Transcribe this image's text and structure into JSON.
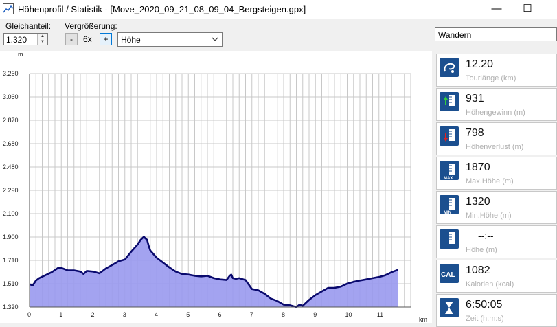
{
  "window": {
    "title": "Höhenprofil / Statistik - [Move_2020_09_21_08_09_04_Bergsteigen.gpx]",
    "minimize": "—",
    "maximize": "☐"
  },
  "toolbar": {
    "gleichanteil_label": "Gleichanteil:",
    "gleichanteil_value": "1.320",
    "zoom_label": "Vergrößerung:",
    "zoom_minus": "-",
    "zoom_value": "6x",
    "zoom_plus": "+",
    "mode_value": "Höhe",
    "activity_value": "Wandern"
  },
  "chart_data": {
    "type": "area",
    "ylabel": "m",
    "xlabel": "km",
    "ylim": [
      1320,
      3260
    ],
    "xlim": [
      0,
      12
    ],
    "y_ticks": [
      "3.260",
      "3.060",
      "2.870",
      "2.680",
      "2.480",
      "2.290",
      "2.100",
      "1.900",
      "1.710",
      "1.510",
      "1.320"
    ],
    "x_ticks": [
      "0",
      "1",
      "2",
      "3",
      "4",
      "5",
      "6",
      "7",
      "8",
      "9",
      "10",
      "11"
    ],
    "grid": true,
    "fill_color": "#9999ee",
    "line_color": "#0a0a6e",
    "series": [
      {
        "x": [
          0.0,
          0.1,
          0.2,
          0.3,
          0.5,
          0.7,
          0.9,
          1.0,
          1.2,
          1.4,
          1.6,
          1.7,
          1.8,
          2.0,
          2.2,
          2.4,
          2.6,
          2.8,
          3.0,
          3.2,
          3.4,
          3.5,
          3.6,
          3.65,
          3.7,
          3.75,
          3.8,
          3.9,
          4.0,
          4.2,
          4.4,
          4.6,
          4.8,
          5.0,
          5.2,
          5.4,
          5.6,
          5.8,
          6.0,
          6.2,
          6.3,
          6.35,
          6.4,
          6.5,
          6.6,
          6.8,
          7.0,
          7.2,
          7.4,
          7.6,
          7.8,
          8.0,
          8.2,
          8.4,
          8.5,
          8.6,
          8.8,
          9.0,
          9.2,
          9.4,
          9.6,
          9.8,
          10.0,
          10.2,
          10.4,
          10.6,
          10.8,
          11.0,
          11.2,
          11.4,
          11.6
        ],
        "y": [
          1510,
          1500,
          1540,
          1560,
          1585,
          1610,
          1645,
          1645,
          1625,
          1625,
          1615,
          1595,
          1620,
          1615,
          1600,
          1640,
          1670,
          1700,
          1715,
          1780,
          1840,
          1880,
          1905,
          1890,
          1880,
          1830,
          1790,
          1760,
          1730,
          1690,
          1650,
          1615,
          1595,
          1590,
          1580,
          1575,
          1580,
          1560,
          1550,
          1545,
          1580,
          1590,
          1560,
          1555,
          1560,
          1545,
          1470,
          1460,
          1430,
          1390,
          1370,
          1340,
          1335,
          1320,
          1340,
          1330,
          1380,
          1420,
          1450,
          1480,
          1480,
          1490,
          1515,
          1530,
          1540,
          1550,
          1560,
          1570,
          1585,
          1610,
          1630
        ]
      }
    ]
  },
  "stats": [
    {
      "icon": "tour-length-icon",
      "value": "12.20",
      "caption": "Tourlänge (km)"
    },
    {
      "icon": "elevation-gain-icon",
      "value": "931",
      "caption": "Höhengewinn (m)"
    },
    {
      "icon": "elevation-loss-icon",
      "value": "798",
      "caption": "Höhenverlust (m)"
    },
    {
      "icon": "max-height-icon",
      "value": "1870",
      "caption": "Max.Höhe (m)",
      "badge": "MAX"
    },
    {
      "icon": "min-height-icon",
      "value": "1320",
      "caption": "Min.Höhe (m)",
      "badge": "MIN"
    },
    {
      "icon": "current-height-icon",
      "value": "--:--",
      "caption": "Höhe (m)"
    },
    {
      "icon": "calories-icon",
      "value": "1082",
      "caption": "Kalorien (kcal)",
      "badge": "CAL"
    },
    {
      "icon": "time-icon",
      "value": "6:50:05",
      "caption": "Zeit (h:m:s)"
    }
  ]
}
